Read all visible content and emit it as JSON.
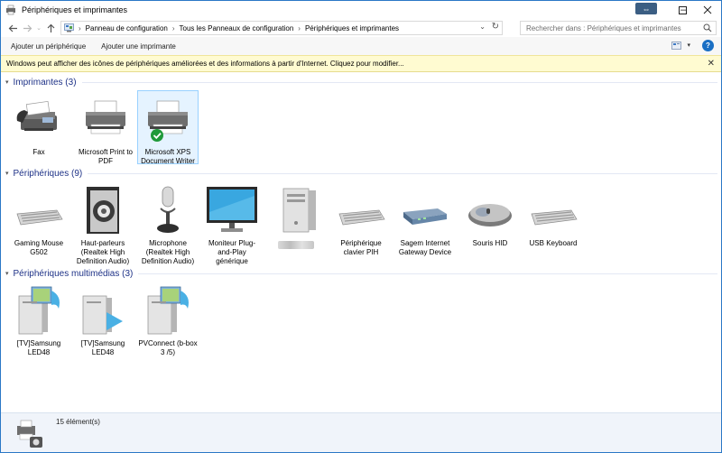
{
  "window": {
    "title": "Périphériques et imprimantes",
    "swap_label": "⇔"
  },
  "address": {
    "breadcrumbs": [
      "Panneau de configuration",
      "Tous les Panneaux de configuration",
      "Périphériques et imprimantes"
    ],
    "search_placeholder": "Rechercher dans : Périphériques et imprimantes"
  },
  "commands": {
    "add_device": "Ajouter un périphérique",
    "add_printer": "Ajouter une imprimante",
    "help": "?"
  },
  "infobar": {
    "message": "Windows peut afficher des icônes de périphériques améliorées et des informations à partir d'Internet. Cliquez pour modifier..."
  },
  "groups": {
    "printers": {
      "title": "Imprimantes (3)",
      "items": [
        {
          "label": "Fax",
          "icon": "fax-icon"
        },
        {
          "label": "Microsoft Print to PDF",
          "icon": "printer-icon"
        },
        {
          "label": "Microsoft XPS Document Writer",
          "icon": "printer-default-icon",
          "selected": true
        }
      ]
    },
    "devices": {
      "title": "Périphériques (9)",
      "items": [
        {
          "label": "Gaming Mouse G502",
          "icon": "keyboard-icon"
        },
        {
          "label": "Haut-parleurs (Realtek High Definition Audio)",
          "icon": "speaker-icon"
        },
        {
          "label": "Microphone (Realtek High Definition Audio)",
          "icon": "microphone-icon"
        },
        {
          "label": "Moniteur Plug-and-Play générique",
          "icon": "monitor-icon"
        },
        {
          "label": "",
          "icon": "computer-tower-icon",
          "blurred": true
        },
        {
          "label": "Périphérique clavier PIH",
          "icon": "keyboard-icon"
        },
        {
          "label": "Sagem Internet Gateway Device",
          "icon": "router-icon"
        },
        {
          "label": "Souris HID",
          "icon": "mouse-icon"
        },
        {
          "label": "USB Keyboard",
          "icon": "keyboard-icon"
        }
      ]
    },
    "multimedia": {
      "title": "Périphériques multimédias (3)",
      "items": [
        {
          "label": "[TV]Samsung LED48",
          "icon": "media-server-icon"
        },
        {
          "label": "[TV]Samsung LED48",
          "icon": "media-renderer-icon"
        },
        {
          "label": "PVConnect (b-box 3 /5)",
          "icon": "media-server-icon"
        }
      ]
    }
  },
  "status": {
    "count_text": "15 élément(s)"
  },
  "colors": {
    "group_title": "#1e3287",
    "infobar_bg": "#fffbd1",
    "selection_bg": "#e5f3ff",
    "statusbar_bg": "#f0f4fa"
  }
}
